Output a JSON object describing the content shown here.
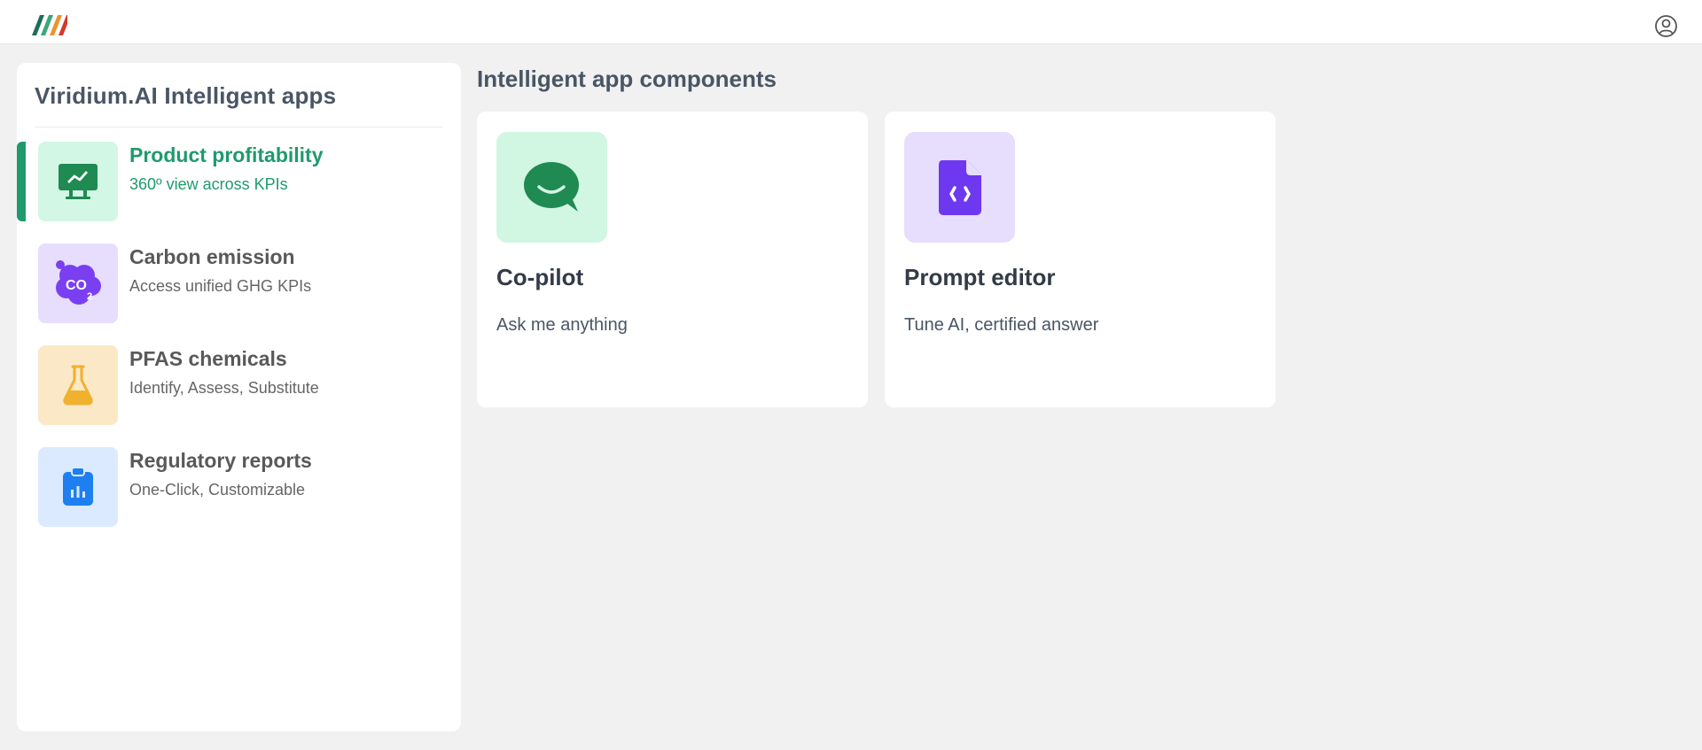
{
  "header": {
    "logo_icon": "striped-logo-icon",
    "user_icon": "user-account-icon"
  },
  "sidebar": {
    "title": "Viridium.AI Intelligent apps",
    "items": [
      {
        "label": "Product profitability",
        "description": "360º view across KPIs",
        "icon": "monitor-chart-icon",
        "tile_color": "#d3f7e5",
        "icon_color": "#1f8a52",
        "active": true
      },
      {
        "label": "Carbon emission",
        "description": "Access unified GHG KPIs",
        "icon": "co2-cloud-icon",
        "tile_color": "#e6defc",
        "icon_color": "#7b3ff2",
        "active": false
      },
      {
        "label": "PFAS chemicals",
        "description": "Identify, Assess, Substitute",
        "icon": "flask-icon",
        "tile_color": "#fbe8c7",
        "icon_color": "#f0b12e",
        "active": false
      },
      {
        "label": "Regulatory reports",
        "description": "One-Click, Customizable",
        "icon": "clipboard-chart-icon",
        "tile_color": "#dbeafe",
        "icon_color": "#1e7ff0",
        "active": false
      }
    ]
  },
  "main": {
    "title": "Intelligent app components",
    "cards": [
      {
        "title": "Co-pilot",
        "description": "Ask me anything",
        "icon": "chat-bubble-icon",
        "tile_color": "#d1f6e2",
        "icon_color": "#1f8a52"
      },
      {
        "title": "Prompt editor",
        "description": "Tune AI, certified answer",
        "icon": "code-file-icon",
        "tile_color": "#e6defc",
        "icon_color": "#6d38f0"
      }
    ]
  }
}
